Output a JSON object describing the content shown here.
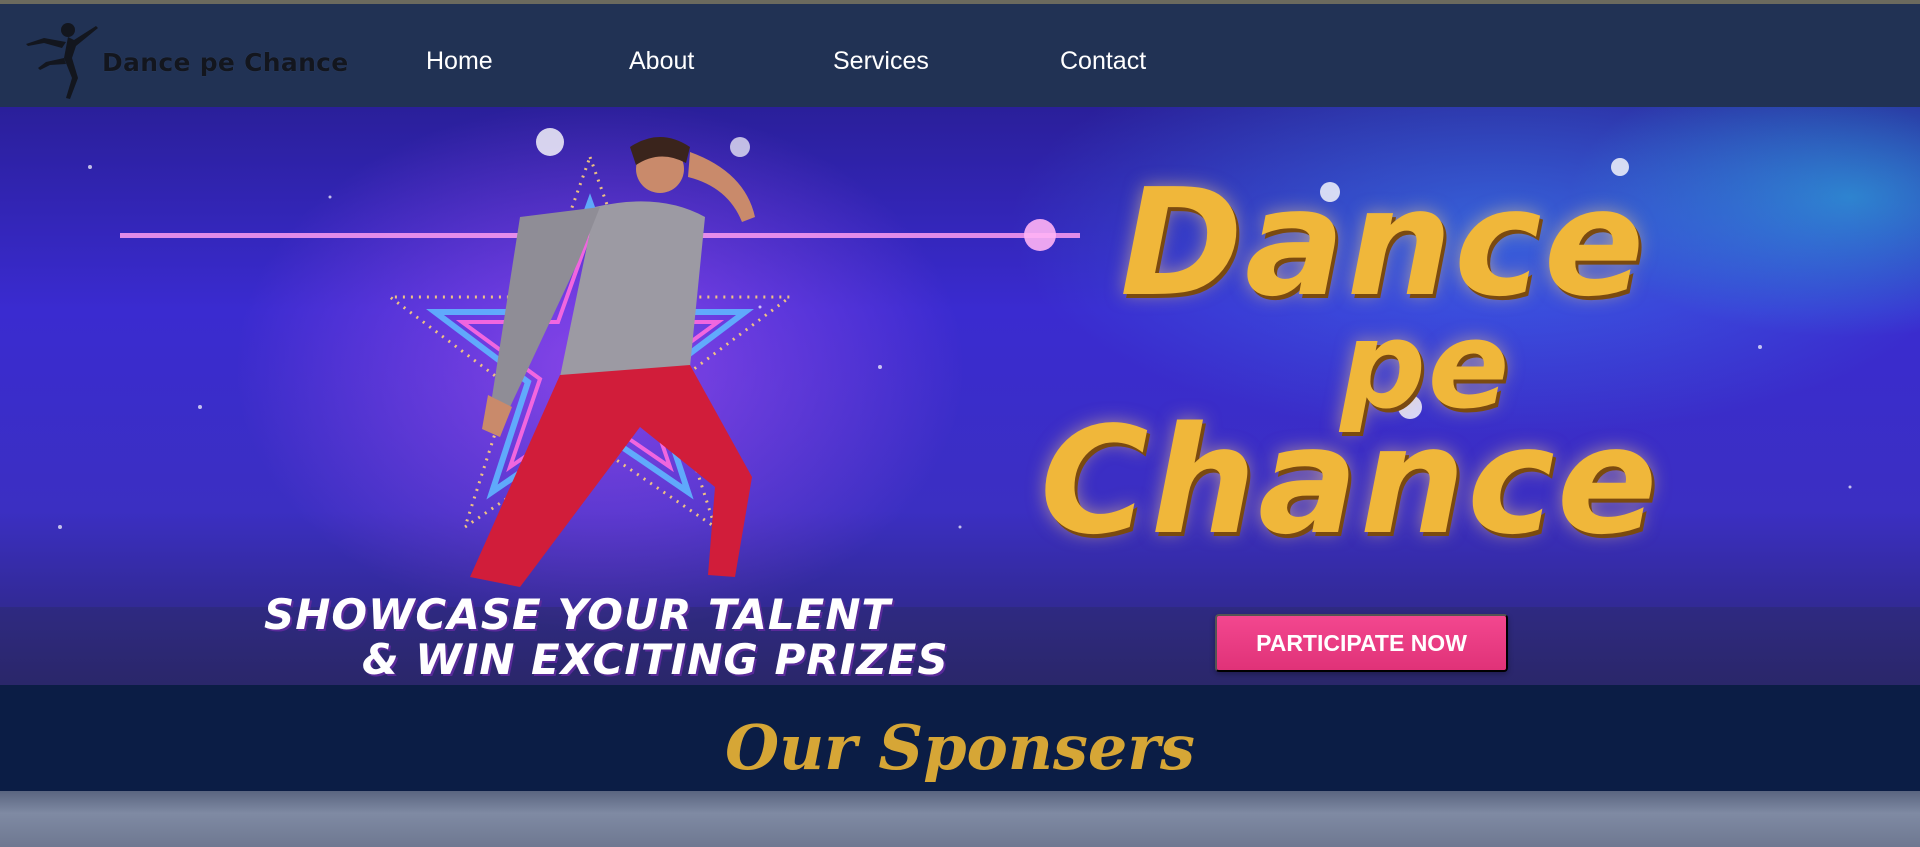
{
  "brand": {
    "name": "Dance pe Chance"
  },
  "nav": {
    "items": [
      {
        "label": "Home"
      },
      {
        "label": "About"
      },
      {
        "label": "Services"
      },
      {
        "label": "Contact"
      }
    ]
  },
  "hero": {
    "title_line1": "Dance",
    "title_line2": "pe",
    "title_line3": "Chance",
    "tagline_line1": "SHOWCASE YOUR TALENT",
    "tagline_line2": "& WIN EXCITING PRIZES",
    "cta_label": "PARTICIPATE NOW"
  },
  "sponsors": {
    "heading": "Our Sponsers"
  },
  "colors": {
    "navbar": "#213254",
    "sponsors_bg": "#0b1d45",
    "heading_gold": "#d6a636",
    "cta_pink": "#f3478f"
  }
}
